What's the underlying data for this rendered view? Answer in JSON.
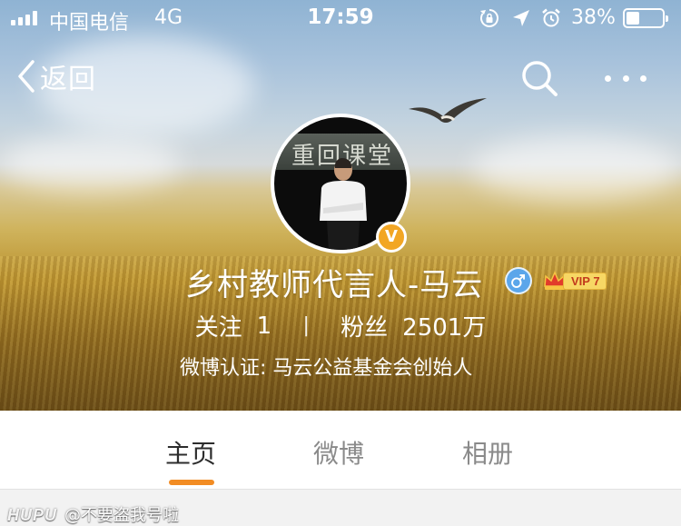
{
  "status_bar": {
    "carrier": "中国电信",
    "network": "4G",
    "time": "17:59",
    "battery_percent_label": "38%",
    "battery_level": 0.38,
    "icons": [
      "signal-icon",
      "rotation-lock-icon",
      "location-arrow-icon",
      "alarm-icon",
      "battery-icon"
    ]
  },
  "nav": {
    "back_label": "返回",
    "icons": [
      "chevron-left-icon",
      "search-icon",
      "more-dots-icon"
    ]
  },
  "profile": {
    "avatar_sign_text": "重回课堂",
    "name": "乡村教师代言人-马云",
    "verified_badge": "V",
    "gender": "male",
    "gender_icon_color": "#5ba6ea",
    "vip_label": "VIP 7",
    "following_label": "关注",
    "following_count": "1",
    "separator": "|",
    "followers_label": "粉丝",
    "followers_count": "2501万",
    "verification_text": "微博认证: 马云公益基金会创始人"
  },
  "tabs": [
    {
      "label": "主页",
      "active": true
    },
    {
      "label": "微博",
      "active": false
    },
    {
      "label": "相册",
      "active": false
    }
  ],
  "watermark": {
    "logo": "HUPU",
    "text": "@不要盗我号啦"
  },
  "colors": {
    "accent": "#f28c23",
    "verified": "#f2a624",
    "tab_active": "#2c2c2c",
    "tab_inactive": "#8a8a8a"
  }
}
